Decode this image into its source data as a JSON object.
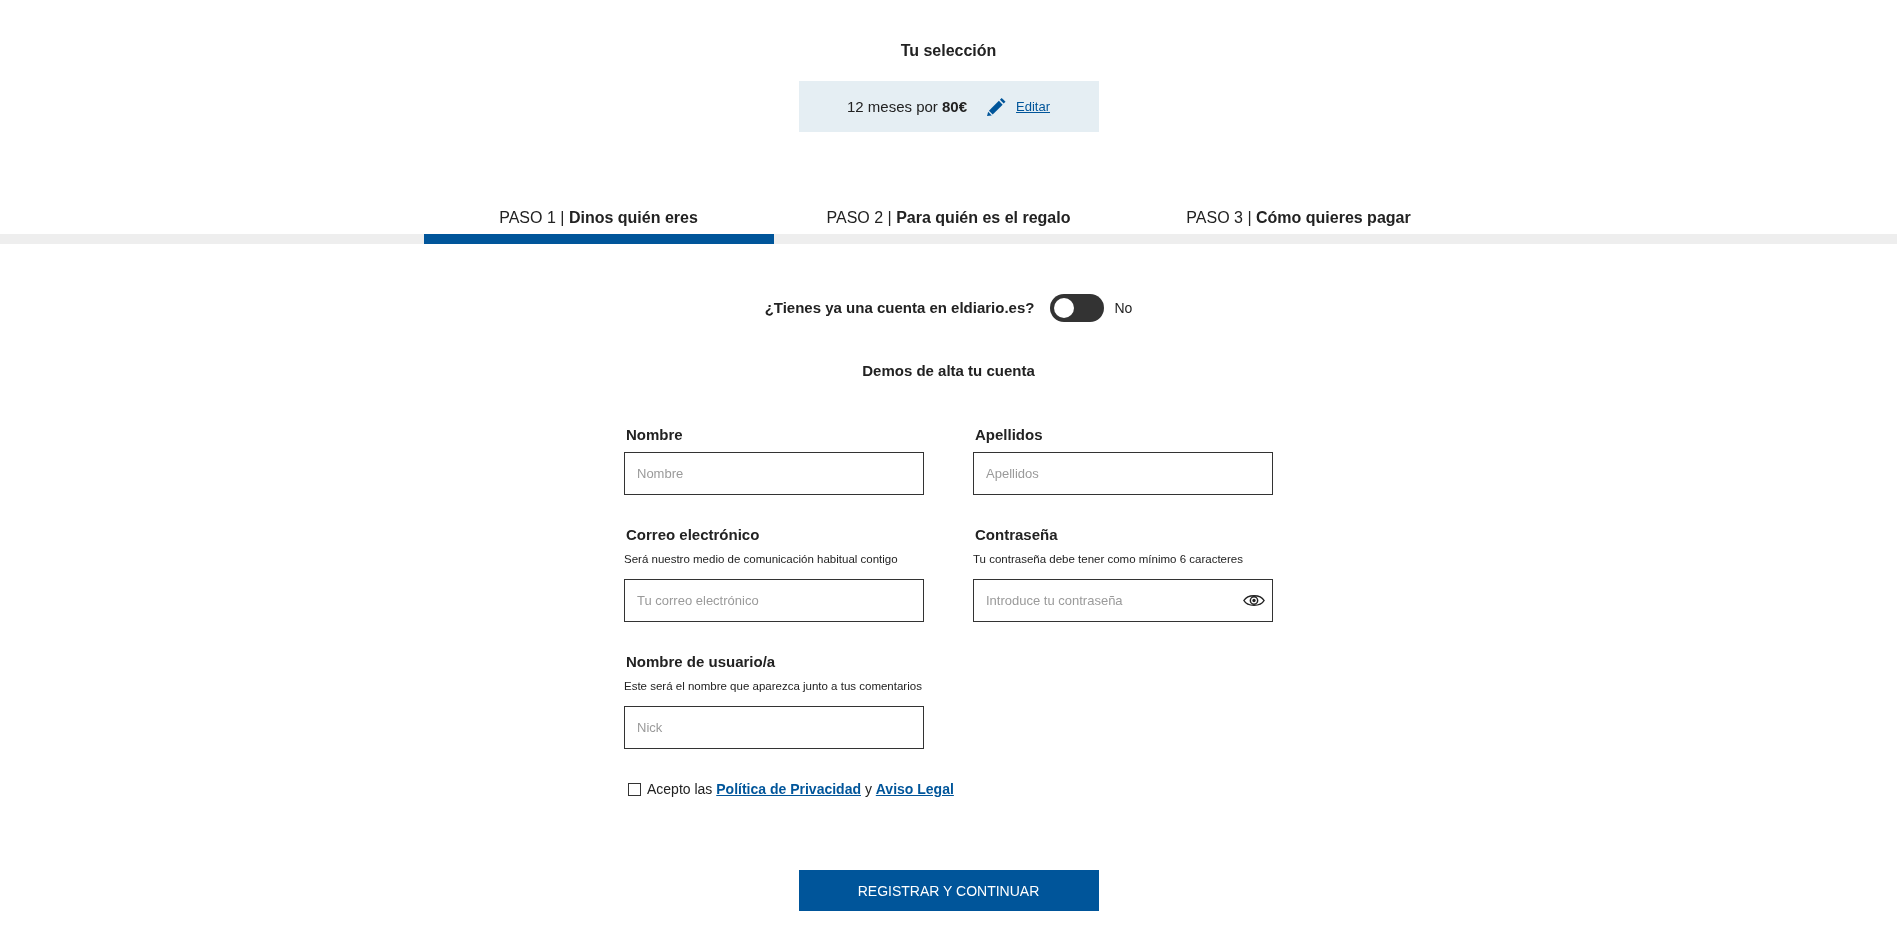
{
  "selection": {
    "title": "Tu selección",
    "summary": "12 meses por **80€**",
    "edit_link": "Editar"
  },
  "steps": [
    {
      "label": "PASO 1 | **Dinos quién eres**",
      "selected": true
    },
    {
      "label": "PASO 2 | **Para quién es el regalo**",
      "selected": false
    },
    {
      "label": "PASO 3 | **Cómo quieres pagar**",
      "selected": false
    }
  ],
  "account_question": {
    "text": "¿Tienes ya una cuenta en eldiario.es?",
    "on": false,
    "state_label": "No"
  },
  "signup": {
    "title": "Demos de alta tu cuenta",
    "fields": [
      {
        "kind": "text",
        "label": "Nombre",
        "placeholder": "Nombre"
      },
      {
        "kind": "text",
        "label": "Apellidos",
        "placeholder": "Apellidos"
      },
      {
        "kind": "text",
        "label": "Correo electrónico",
        "hint": "Será nuestro medio de comunicación habitual contigo",
        "placeholder": "Tu correo electrónico"
      },
      {
        "kind": "password",
        "label": "Contraseña",
        "hint": "Tu contraseña debe tener como mínimo 6 caracteres",
        "placeholder": "Introduce tu contraseña"
      },
      {
        "kind": "text",
        "label": "Nombre de usuario/a",
        "hint": "Este será el nombre que aparezca junto a tus comentarios",
        "placeholder": "Nick"
      }
    ]
  },
  "consent": {
    "checked": false,
    "parts": [
      {
        "kind": "text",
        "text": "Acepto las"
      },
      {
        "kind": "link",
        "text": "Política de Privacidad"
      },
      {
        "kind": "text",
        "text": "y"
      },
      {
        "kind": "link",
        "text": "Aviso Legal"
      }
    ]
  },
  "submit_button": "REGISTRAR Y CONTINUAR"
}
